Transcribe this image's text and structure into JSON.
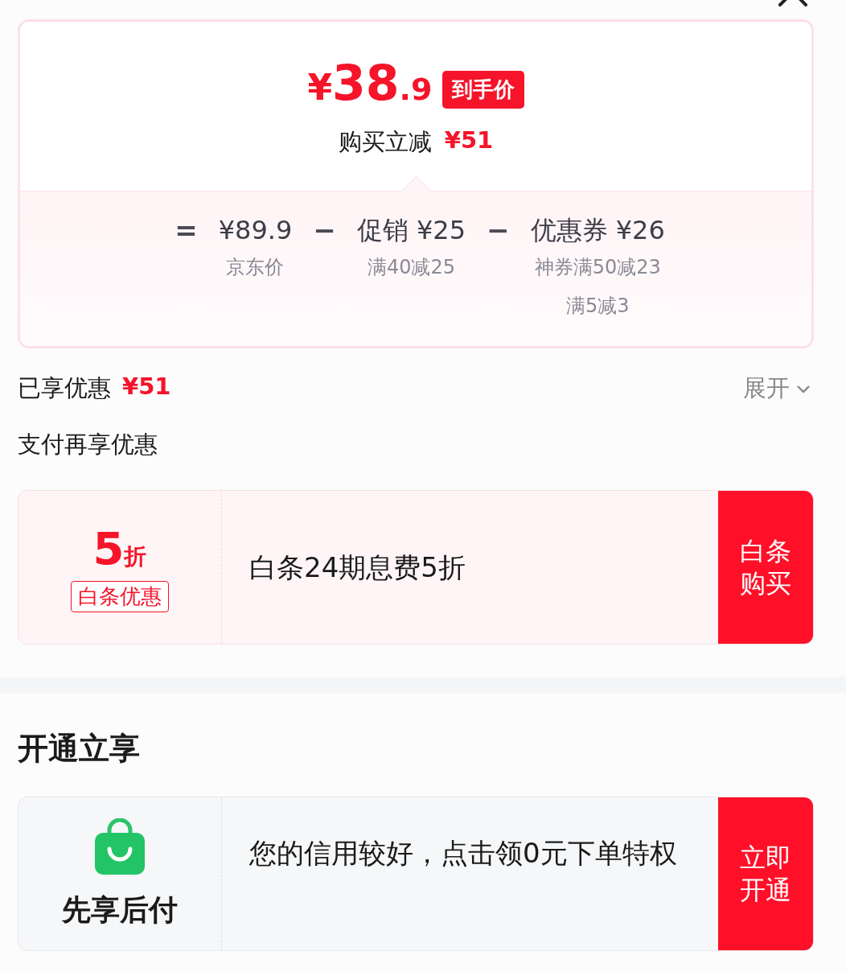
{
  "price_card": {
    "currency": "¥",
    "integer": "38",
    "decimal": ".9",
    "badge": "到手价",
    "saving_label": "购买立减",
    "saving_amount": "¥51",
    "terms": [
      {
        "operator": "=",
        "amount": "¥89.9",
        "notes": [
          "京东价"
        ]
      },
      {
        "operator": "−",
        "label": "促销",
        "amount": "¥25",
        "notes": [
          "满40减25"
        ]
      },
      {
        "operator": "−",
        "label": "优惠券",
        "amount": "¥26",
        "notes": [
          "神券满50减23",
          "满5减3"
        ]
      }
    ]
  },
  "summary": {
    "label": "已享优惠",
    "amount": "¥51",
    "toggle": "展开",
    "expanded": false
  },
  "sections": [
    {
      "title": "支付再享优惠",
      "kind": "subheading",
      "offers": [
        {
          "kind": "discount",
          "value": "5",
          "unit": "折",
          "tag": "白条优惠",
          "text": "白条24期息费5折",
          "button": "白条购买"
        }
      ]
    },
    {
      "title": "开通立享",
      "kind": "heading",
      "offers": [
        {
          "kind": "app",
          "label": "先享后付",
          "text": "您的信用较好，点击领0元下单特权",
          "button": "立即开通"
        }
      ]
    }
  ]
}
